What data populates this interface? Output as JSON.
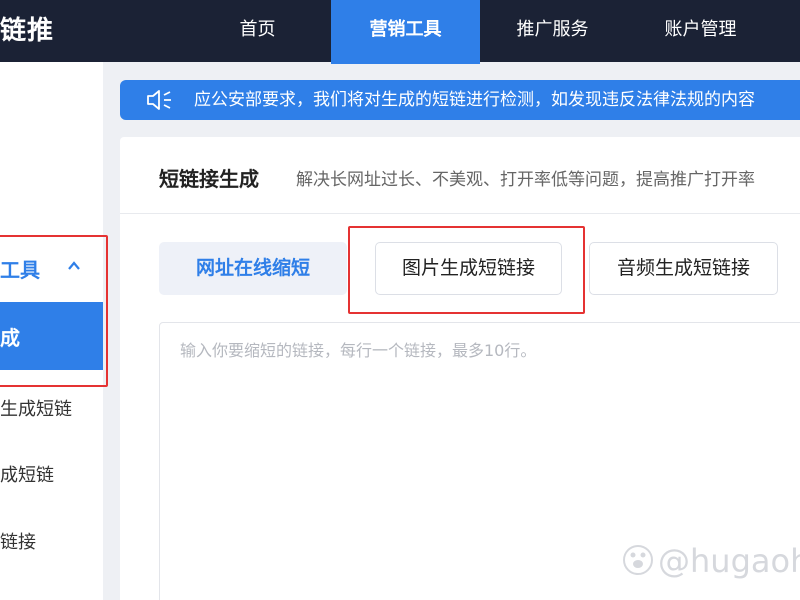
{
  "header": {
    "logo": "链推",
    "nav": [
      {
        "label": "首页"
      },
      {
        "label": "营销工具"
      },
      {
        "label": "推广服务"
      },
      {
        "label": "账户管理"
      }
    ]
  },
  "sidebar": {
    "group_label": "工具",
    "active_item": "成",
    "items": [
      {
        "label": "生成短链"
      },
      {
        "label": "成短链"
      },
      {
        "label": "链接"
      }
    ]
  },
  "notice": {
    "text": "应公安部要求，我们将对生成的短链进行检测，如发现违反法律法规的内容"
  },
  "panel": {
    "title": "短链接生成",
    "description": "解决长网址过长、不美观、打开率低等问题，提高推广打开率",
    "tabs": [
      {
        "label": "网址在线缩短"
      },
      {
        "label": "图片生成短链接"
      },
      {
        "label": "音频生成短链接"
      }
    ],
    "input_placeholder": "输入你要缩短的链接，每行一个链接，最多10行。"
  },
  "watermark": {
    "text": "@hugaoh"
  },
  "colors": {
    "accent": "#2f7fe8",
    "topbar": "#1b2235",
    "highlight": "#e53232"
  }
}
